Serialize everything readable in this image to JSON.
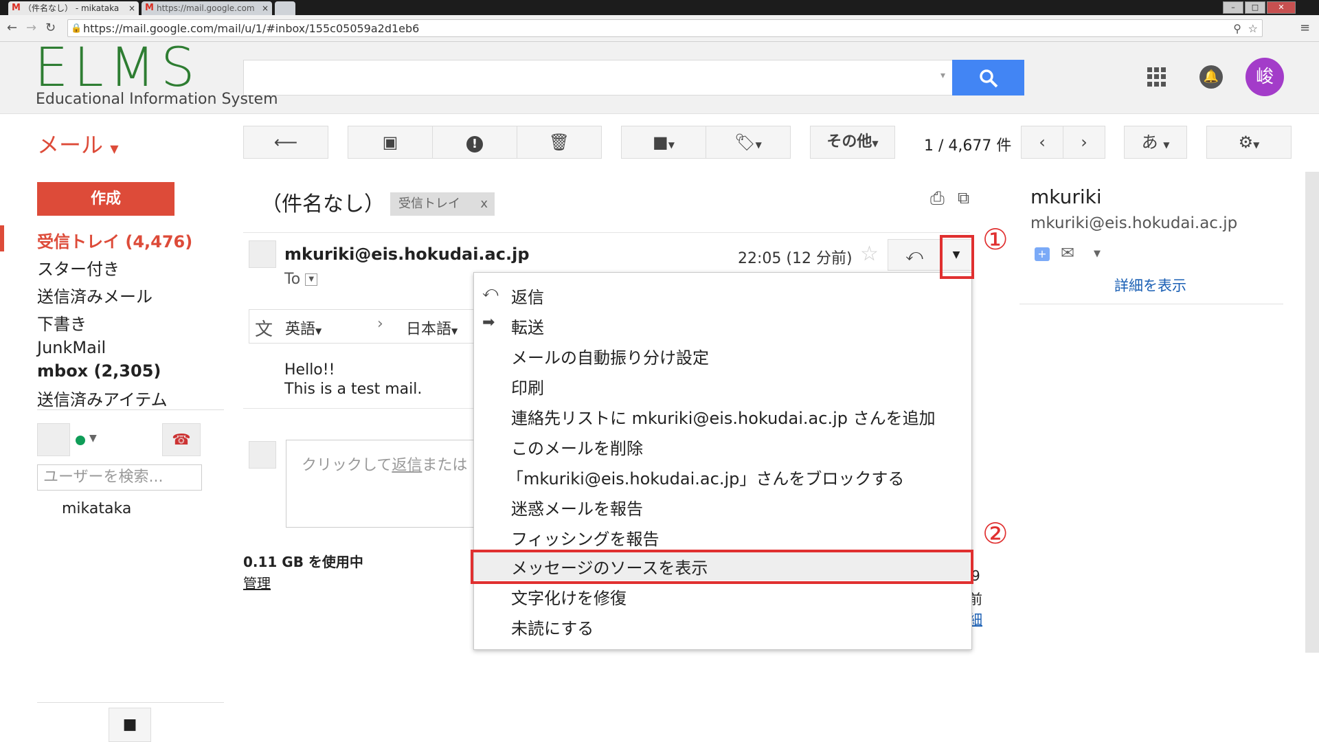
{
  "browser": {
    "tabs": [
      {
        "label": "（件名なし） - mikataka"
      },
      {
        "label": "https://mail.google.com"
      }
    ],
    "url": "https://mail.google.com/mail/u/1/#inbox/155c05059a2d1eb6"
  },
  "header": {
    "logo_main": "ELMS",
    "logo_sub": "Educational Information System",
    "avatar_letter": "峻",
    "search_placeholder": ""
  },
  "toolbar": {
    "mail_label": "メール",
    "other_label": "その他",
    "counter": "1 / 4,677 件",
    "input_tool": "あ"
  },
  "sidebar": {
    "compose": "作成",
    "items": [
      {
        "label": "受信トレイ (4,476)"
      },
      {
        "label": "スター付き"
      },
      {
        "label": "送信済みメール"
      },
      {
        "label": "下書き"
      },
      {
        "label": "JunkMail"
      },
      {
        "label": "mbox (2,305)"
      },
      {
        "label": "送信済みアイテム"
      }
    ],
    "user_search_placeholder": "ユーザーを検索...",
    "user_name": "mikataka",
    "storage": "0.11 GB を使用中",
    "manage": "管理"
  },
  "thread": {
    "subject": "（件名なし）",
    "label": "受信トレイ",
    "label_close": "x",
    "sender": "mkuriki@eis.hokudai.ac.jp",
    "timestamp": "22:05 (12 分前)",
    "to": "To",
    "translate_from": "英語",
    "translate_to": "日本語",
    "body_line1": "Hello!!",
    "body_line2": "This is a test mail.",
    "reply_prompt_a": "クリックして",
    "reply_prompt_link": "返信",
    "reply_prompt_b": "または"
  },
  "menu": {
    "items": [
      {
        "label": "返信"
      },
      {
        "label": "転送"
      },
      {
        "label": "メールの自動振り分け設定"
      },
      {
        "label": "印刷"
      },
      {
        "label": "連絡先リストに mkuriki@eis.hokudai.ac.jp さんを追加"
      },
      {
        "label": "このメールを削除"
      },
      {
        "label": "「mkuriki@eis.hokudai.ac.jp」さんをブロックする"
      },
      {
        "label": "迷惑メールを報告"
      },
      {
        "label": "フィッシングを報告"
      },
      {
        "label": "メッセージのソースを表示"
      },
      {
        "label": "文字化けを修復"
      },
      {
        "label": "未読にする"
      }
    ]
  },
  "contact": {
    "name": "mkuriki",
    "email": "mkuriki@eis.hokudai.ac.jp",
    "details": "詳細を表示"
  },
  "annotations": {
    "step1": "①",
    "step2": "②",
    "color": "#e03030"
  },
  "partial_right": {
    "line1": "9",
    "line2": "前",
    "line3": "細"
  }
}
